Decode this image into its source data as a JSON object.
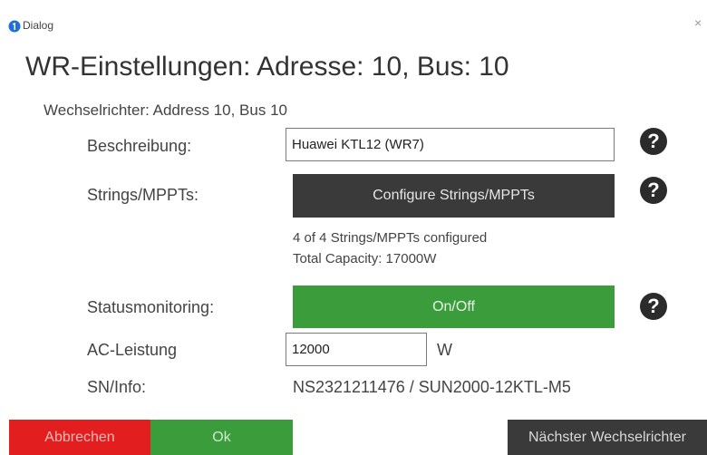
{
  "window": {
    "title": "Dialog",
    "close_glyph": "×",
    "icon": "app-logo-icon"
  },
  "heading": "WR-Einstellungen: Adresse: 10, Bus: 10",
  "subheading": "Wechselrichter: Address 10, Bus 10",
  "form": {
    "description": {
      "label": "Beschreibung:",
      "value": "Huawei KTL12 (WR7)"
    },
    "strings": {
      "label": "Strings/MPPTs:",
      "button_label": "Configure Strings/MPPTs",
      "info_configured": "4 of 4 Strings/MPPTs configured",
      "info_capacity": "Total Capacity: 17000W"
    },
    "status": {
      "label": "Statusmonitoring:",
      "button_label": "On/Off"
    },
    "ac_power": {
      "label": "AC-Leistung",
      "value": "12000",
      "unit": "W"
    },
    "sn_info": {
      "label": "SN/Info:",
      "value": "NS2321211476 / SUN2000-12KTL-M5"
    },
    "help_glyph": "?"
  },
  "footer": {
    "cancel_label": "Abbrechen",
    "ok_label": "Ok",
    "next_label": "Nächster Wechselrichter"
  },
  "colors": {
    "cancel": "#e31e1e",
    "ok": "#3b9c3b",
    "dark_button": "#3a3a3a",
    "toggle_on": "#3b9c3b"
  }
}
